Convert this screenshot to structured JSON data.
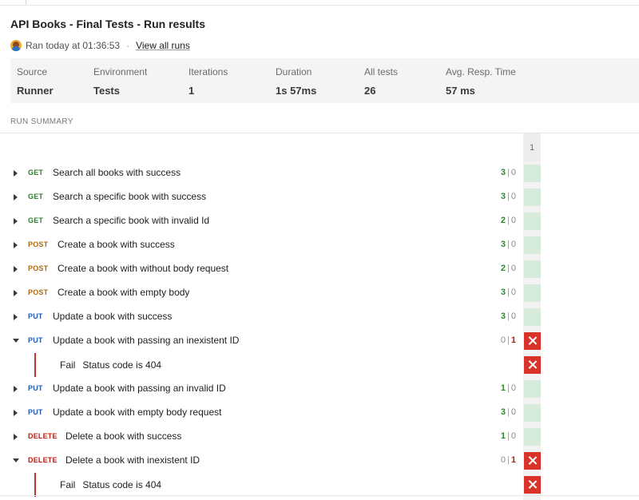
{
  "title": "API Books - Final Tests - Run results",
  "run_info": {
    "ran_text": "Ran today at 01:36:53",
    "separator": "·",
    "view_all_runs": "View all runs"
  },
  "stats": [
    {
      "label": "Source",
      "value": "Runner"
    },
    {
      "label": "Environment",
      "value": "Tests"
    },
    {
      "label": "Iterations",
      "value": "1"
    },
    {
      "label": "Duration",
      "value": "1s 57ms"
    },
    {
      "label": "All tests",
      "value": "26"
    },
    {
      "label": "Avg. Resp. Time",
      "value": "57 ms"
    }
  ],
  "summary_label": "RUN SUMMARY",
  "iteration_header": "1",
  "colors": {
    "pass_cell": "#d7ebdc",
    "fail_cell": "#d7332b",
    "get": "#2b7d2b",
    "post": "#b06a0b",
    "put": "#1f5bb5",
    "delete": "#b42318"
  },
  "requests": [
    {
      "method": "GET",
      "name": "Search all books with success",
      "passed": "3",
      "failed": "0",
      "status": "pass",
      "expanded": false
    },
    {
      "method": "GET",
      "name": "Search a specific book with success",
      "passed": "3",
      "failed": "0",
      "status": "pass",
      "expanded": false
    },
    {
      "method": "GET",
      "name": "Search a specific book with invalid Id",
      "passed": "2",
      "failed": "0",
      "status": "pass",
      "expanded": false
    },
    {
      "method": "POST",
      "name": "Create a book with success",
      "passed": "3",
      "failed": "0",
      "status": "pass",
      "expanded": false
    },
    {
      "method": "POST",
      "name": "Create a book with without body request",
      "passed": "2",
      "failed": "0",
      "status": "pass",
      "expanded": false
    },
    {
      "method": "POST",
      "name": "Create a book with empty body",
      "passed": "3",
      "failed": "0",
      "status": "pass",
      "expanded": false
    },
    {
      "method": "PUT",
      "name": "Update a book with success",
      "passed": "3",
      "failed": "0",
      "status": "pass",
      "expanded": false
    },
    {
      "method": "PUT",
      "name": "Update a book with passing an inexistent ID",
      "passed": "0",
      "failed": "1",
      "status": "fail",
      "expanded": true,
      "failures": [
        {
          "label": "Fail",
          "test": "Status code is 404"
        }
      ]
    },
    {
      "method": "PUT",
      "name": "Update a book with passing an invalid ID",
      "passed": "1",
      "failed": "0",
      "status": "pass",
      "expanded": false
    },
    {
      "method": "PUT",
      "name": "Update a book with empty body request",
      "passed": "3",
      "failed": "0",
      "status": "pass",
      "expanded": false
    },
    {
      "method": "DELETE",
      "name": "Delete a book with success",
      "passed": "1",
      "failed": "0",
      "status": "pass",
      "expanded": false
    },
    {
      "method": "DELETE",
      "name": "Delete a book with inexistent ID",
      "passed": "0",
      "failed": "1",
      "status": "fail",
      "expanded": true,
      "failures": [
        {
          "label": "Fail",
          "test": "Status code is 404"
        }
      ]
    }
  ]
}
